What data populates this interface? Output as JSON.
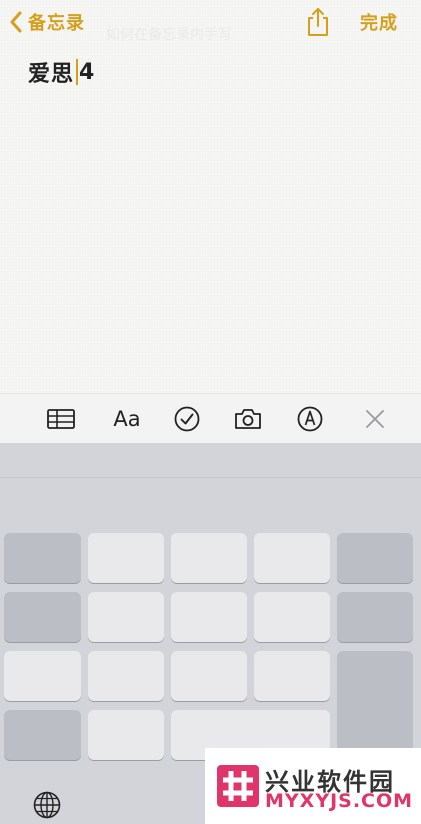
{
  "nav": {
    "back_label": "备忘录",
    "done_label": "完成",
    "faint_text": "如何在备忘录内手写"
  },
  "note": {
    "text_before_caret": "爱思",
    "text_after_caret": "4"
  },
  "toolbar": {
    "format_label": "Aa",
    "items": [
      "table-icon",
      "format-text",
      "checklist-icon",
      "camera-icon",
      "markup-icon",
      "close-icon"
    ]
  },
  "keyboard": {
    "icons": [
      "globe-icon"
    ]
  },
  "watermark": {
    "cn": "兴业软件园",
    "en": "MYXYJS.COM"
  },
  "colors": {
    "accent": "#d6a01c",
    "watermark_pink": "#e0356b"
  }
}
